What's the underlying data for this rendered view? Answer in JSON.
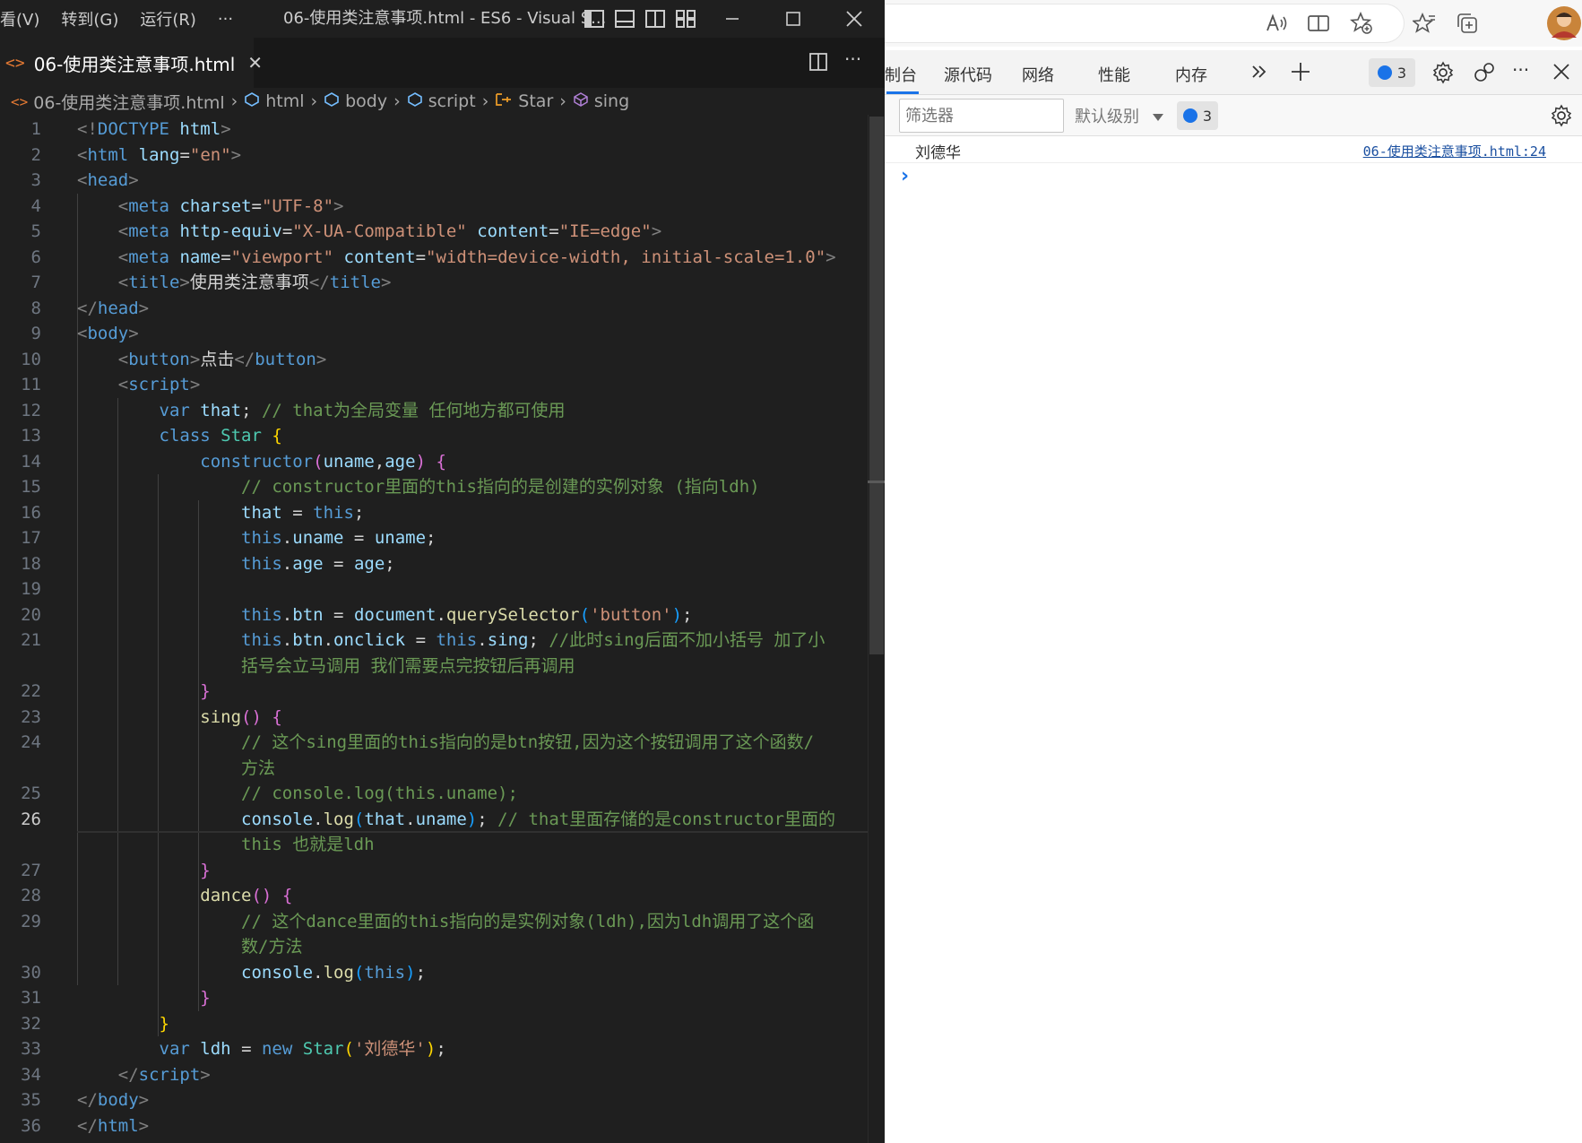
{
  "vscode": {
    "menus": [
      "看(V)",
      "转到(G)",
      "运行(R)",
      "···"
    ],
    "window_title": "06-使用类注意事项.html - ES6 - Visual S...",
    "tab": {
      "filename": "06-使用类注意事项.html",
      "close": "✕"
    },
    "breadcrumb": [
      "06-使用类注意事项.html",
      "html",
      "body",
      "script",
      "Star",
      "sing"
    ],
    "active_line": 26
  },
  "browser": {
    "devtools_tabs": [
      "制台",
      "源代码",
      "网络",
      "性能",
      "内存"
    ],
    "message_count": "3",
    "filter_placeholder": "筛选器",
    "level_label": "默认级别",
    "console_log": {
      "message": "刘德华",
      "source": "06-使用类注意事项.html:24"
    }
  },
  "code_lines": [
    {
      "n": 1,
      "html": "<span class='br'>&lt;!</span><span class='tg'>DOCTYPE</span> <span class='at'>html</span><span class='br'>&gt;</span>"
    },
    {
      "n": 2,
      "html": "<span class='br'>&lt;</span><span class='tg'>html</span> <span class='at'>lang</span><span class='tx'>=</span><span class='st'>\"en\"</span><span class='br'>&gt;</span>"
    },
    {
      "n": 3,
      "html": "<span class='br'>&lt;</span><span class='tg'>head</span><span class='br'>&gt;</span>"
    },
    {
      "n": 4,
      "html": "    <span class='br'>&lt;</span><span class='tg'>meta</span> <span class='at'>charset</span><span class='tx'>=</span><span class='st'>\"UTF-8\"</span><span class='br'>&gt;</span>"
    },
    {
      "n": 5,
      "html": "    <span class='br'>&lt;</span><span class='tg'>meta</span> <span class='at'>http-equiv</span><span class='tx'>=</span><span class='st'>\"X-UA-Compatible\"</span> <span class='at'>content</span><span class='tx'>=</span><span class='st'>\"IE=edge\"</span><span class='br'>&gt;</span>"
    },
    {
      "n": 6,
      "html": "    <span class='br'>&lt;</span><span class='tg'>meta</span> <span class='at'>name</span><span class='tx'>=</span><span class='st'>\"viewport\"</span> <span class='at'>content</span><span class='tx'>=</span><span class='st'>\"width=device-width, initial-scale=1.0\"</span><span class='br'>&gt;</span>"
    },
    {
      "n": 7,
      "html": "    <span class='br'>&lt;</span><span class='tg'>title</span><span class='br'>&gt;</span><span class='tx'>使用类注意事项</span><span class='br'>&lt;/</span><span class='tg'>title</span><span class='br'>&gt;</span>"
    },
    {
      "n": 8,
      "html": "<span class='br'>&lt;/</span><span class='tg'>head</span><span class='br'>&gt;</span>"
    },
    {
      "n": 9,
      "html": "<span class='br'>&lt;</span><span class='tg'>body</span><span class='br'>&gt;</span>"
    },
    {
      "n": 10,
      "html": "    <span class='br'>&lt;</span><span class='tg'>button</span><span class='br'>&gt;</span><span class='tx'>点击</span><span class='br'>&lt;/</span><span class='tg'>button</span><span class='br'>&gt;</span>"
    },
    {
      "n": 11,
      "html": "    <span class='br'>&lt;</span><span class='tg'>script</span><span class='br'>&gt;</span>"
    },
    {
      "n": 12,
      "html": "        <span class='kw'>var</span> <span class='va'>that</span><span class='tx'>;</span> <span class='cm'>// that为全局变量 任何地方都可使用</span>"
    },
    {
      "n": 13,
      "html": "        <span class='kw'>class</span> <span class='cls'>Star</span> <span class='p1'>{</span>"
    },
    {
      "n": 14,
      "html": "            <span class='kw'>constructor</span><span class='p2'>(</span><span class='va'>uname</span><span class='tx'>,</span><span class='va'>age</span><span class='p2'>)</span> <span class='p2'>{</span>"
    },
    {
      "n": 15,
      "html": "                <span class='cm'>// constructor里面的this指向的是创建的实例对象 (指向ldh)</span>"
    },
    {
      "n": 16,
      "html": "                <span class='va'>that</span> <span class='tx'>=</span> <span class='kw'>this</span><span class='tx'>;</span>"
    },
    {
      "n": 17,
      "html": "                <span class='kw'>this</span><span class='tx'>.</span><span class='va'>uname</span> <span class='tx'>=</span> <span class='va'>uname</span><span class='tx'>;</span>"
    },
    {
      "n": 18,
      "html": "                <span class='kw'>this</span><span class='tx'>.</span><span class='va'>age</span> <span class='tx'>=</span> <span class='va'>age</span><span class='tx'>;</span>"
    },
    {
      "n": 19,
      "html": ""
    },
    {
      "n": 20,
      "html": "                <span class='kw'>this</span><span class='tx'>.</span><span class='va'>btn</span> <span class='tx'>=</span> <span class='va'>document</span><span class='tx'>.</span><span class='fn'>querySelector</span><span class='p3'>(</span><span class='st'>'button'</span><span class='p3'>)</span><span class='tx'>;</span>"
    },
    {
      "n": 21,
      "html": "                <span class='kw'>this</span><span class='tx'>.</span><span class='va'>btn</span><span class='tx'>.</span><span class='va'>onclick</span> <span class='tx'>=</span> <span class='kw'>this</span><span class='tx'>.</span><span class='va'>sing</span><span class='tx'>;</span> <span class='cm'>//此时sing后面不加小括号 加了小</span>"
    },
    {
      "n": "",
      "html": "                <span class='cm'>括号会立马调用 我们需要点完按钮后再调用</span>"
    },
    {
      "n": 22,
      "html": "            <span class='p2'>}</span>"
    },
    {
      "n": 23,
      "html": "            <span class='fn'>sing</span><span class='p2'>()</span> <span class='p2'>{</span>"
    },
    {
      "n": 24,
      "html": "                <span class='cm'>// 这个sing里面的this指向的是btn按钮,因为这个按钮调用了这个函数/</span>"
    },
    {
      "n": "",
      "html": "                <span class='cm'>方法</span>"
    },
    {
      "n": 25,
      "html": "                <span class='cm'>// console.log(this.uname);</span>"
    },
    {
      "n": 26,
      "html": "                <span class='va'>console</span><span class='tx'>.</span><span class='fn'>log</span><span class='p3'>(</span><span class='va'>that</span><span class='tx'>.</span><span class='va'>uname</span><span class='p3'>)</span><span class='tx'>;</span> <span class='cm'>// that里面存储的是constructor里面的</span>"
    },
    {
      "n": "",
      "html": "                <span class='cm'>this 也就是ldh</span>"
    },
    {
      "n": 27,
      "html": "            <span class='p2'>}</span>"
    },
    {
      "n": 28,
      "html": "            <span class='fn'>dance</span><span class='p2'>()</span> <span class='p2'>{</span>"
    },
    {
      "n": 29,
      "html": "                <span class='cm'>// 这个dance里面的this指向的是实例对象(ldh),因为ldh调用了这个函</span>"
    },
    {
      "n": "",
      "html": "                <span class='cm'>数/方法</span>"
    },
    {
      "n": 30,
      "html": "                <span class='va'>console</span><span class='tx'>.</span><span class='fn'>log</span><span class='p3'>(</span><span class='kw'>this</span><span class='p3'>)</span><span class='tx'>;</span>"
    },
    {
      "n": 31,
      "html": "            <span class='p2'>}</span>"
    },
    {
      "n": 32,
      "html": "        <span class='p1'>}</span>"
    },
    {
      "n": 33,
      "html": "        <span class='kw'>var</span> <span class='va'>ldh</span> <span class='tx'>=</span> <span class='kw'>new</span> <span class='cls'>Star</span><span class='p1'>(</span><span class='st'>'刘德华'</span><span class='p1'>)</span><span class='tx'>;</span>"
    },
    {
      "n": 34,
      "html": "    <span class='br'>&lt;/</span><span class='tg'>script</span><span class='br'>&gt;</span>"
    },
    {
      "n": 35,
      "html": "<span class='br'>&lt;/</span><span class='tg'>body</span><span class='br'>&gt;</span>"
    },
    {
      "n": 36,
      "html": "<span class='br'>&lt;/</span><span class='tg'>html</span><span class='br'>&gt;</span>"
    }
  ]
}
